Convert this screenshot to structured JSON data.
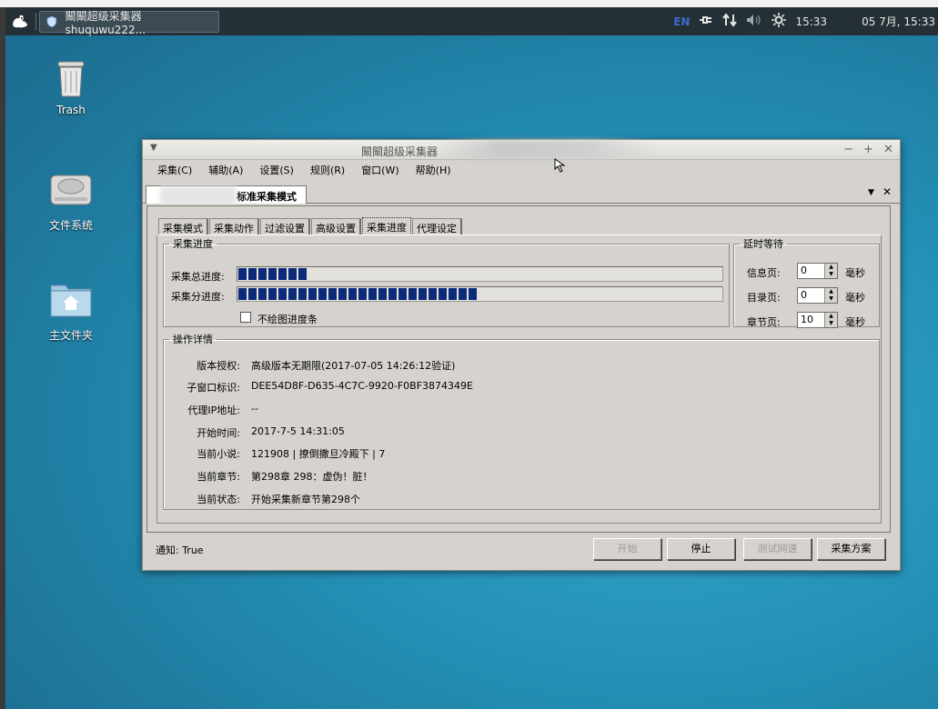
{
  "panel": {
    "task_title": "闞闞超级采集器shuquwu222...",
    "lang": "EN",
    "time": "15:33",
    "datetime": "05 7月, 15:33"
  },
  "desktop": {
    "icons": [
      {
        "label": "Trash",
        "icon": "trash-icon"
      },
      {
        "label": "文件系统",
        "icon": "drive-icon"
      },
      {
        "label": "主文件夹",
        "icon": "home-folder-icon"
      }
    ]
  },
  "window": {
    "title": "闞闞超级采集器",
    "menu": [
      "采集(C)",
      "辅助(A)",
      "设置(S)",
      "规则(R)",
      "窗口(W)",
      "帮助(H)"
    ],
    "doc_tab": "标准采集模式",
    "tabs": [
      "采集模式",
      "采集动作",
      "过滤设置",
      "高级设置",
      "采集进度",
      "代理设定"
    ],
    "active_tab": "采集进度",
    "progress": {
      "group_title": "采集进度",
      "total_label": "采集总进度:",
      "total_fraction": 0.145,
      "sub_label": "采集分进度:",
      "sub_fraction": 0.495,
      "no_draw_label": "不绘图进度条",
      "no_draw_checked": false
    },
    "delay": {
      "group_title": "延时等待",
      "rows": [
        {
          "label": "信息页:",
          "value": "0",
          "unit": "毫秒"
        },
        {
          "label": "目录页:",
          "value": "0",
          "unit": "毫秒"
        },
        {
          "label": "章节页:",
          "value": "10",
          "unit": "毫秒"
        }
      ]
    },
    "details": {
      "group_title": "操作详情",
      "rows": [
        {
          "label": "版本授权:",
          "value": "高级版本无期限(2017-07-05 14:26:12验证)"
        },
        {
          "label": "子窗口标识:",
          "value": "DEE54D8F-D635-4C7C-9920-F0BF3874349E"
        },
        {
          "label": "代理IP地址:",
          "value": "--"
        },
        {
          "label": "开始时间:",
          "value": "2017-7-5 14:31:05"
        },
        {
          "label": "当前小说:",
          "value": "121908 | 撩倒撒旦冷殿下 | 7"
        },
        {
          "label": "当前章节:",
          "value": "第298章 298：虚伪！脏！"
        },
        {
          "label": "当前状态:",
          "value": "开始采集新章节第298个"
        }
      ]
    },
    "status_text": "通知: True",
    "buttons": {
      "start": "开始",
      "stop": "停止",
      "test": "测试网速",
      "plan": "采集方案"
    }
  }
}
